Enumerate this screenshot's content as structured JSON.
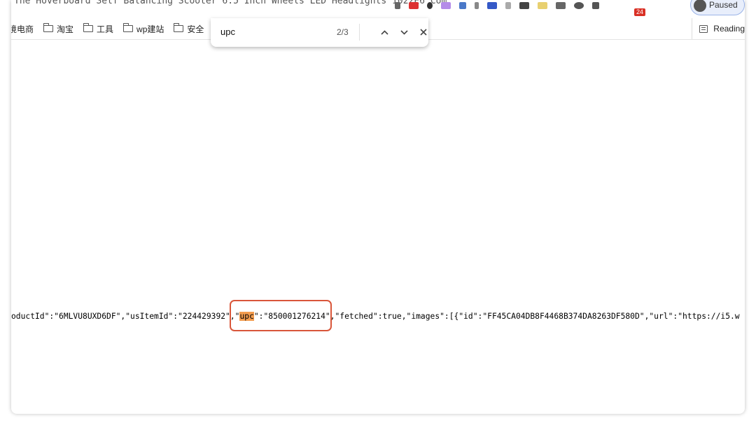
{
  "browser": {
    "url_text": "The Hoverboard Self Balancing Scooter 6.5 Inch Wheels LED Headlights 1022E6 Com",
    "extension_badge": "24",
    "profile_label": "Paused"
  },
  "bookmarks": {
    "items": [
      {
        "label": "跨境电商",
        "icon": "folder-icon"
      },
      {
        "label": "淘宝",
        "icon": "folder-icon"
      },
      {
        "label": "工具",
        "icon": "folder-icon"
      },
      {
        "label": "wp建站",
        "icon": "folder-icon"
      },
      {
        "label": "安全",
        "icon": "folder-icon"
      }
    ],
    "reading_list_label": "Reading"
  },
  "find_bar": {
    "query": "upc",
    "match_count": "2/3",
    "prev_icon": "chevron-up-icon",
    "next_icon": "chevron-down-icon",
    "close_icon": "close-icon"
  },
  "page": {
    "json_before": "oductId\":\"6MLVU8UXD6DF\",\"usItemId\":\"224429392\",\"",
    "json_match": "upc",
    "json_after": "\":\"850001276214\",\"fetched\":true,\"images\":[{\"id\":\"FF45CA04DB8F4468B374DA8263DF580D\",\"url\":\"https://i5.w"
  },
  "colors": {
    "highlight": "#f39c4e",
    "annotation_box": "#d9563a"
  }
}
